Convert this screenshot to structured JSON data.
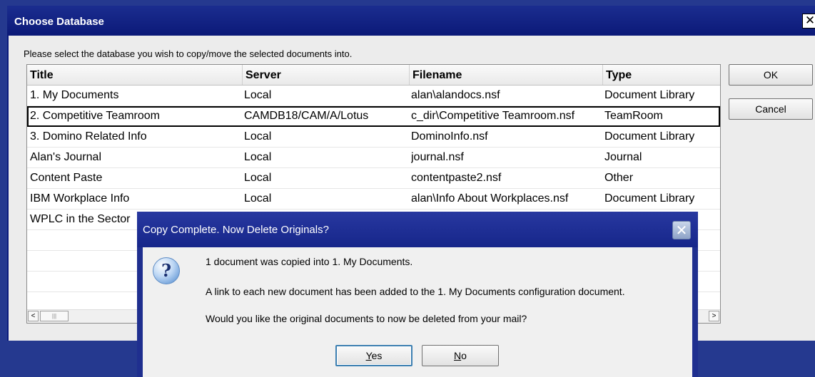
{
  "window": {
    "title": "Choose Database",
    "close_glyph": "✕",
    "instruction": "Please select the database you wish to copy/move the selected documents into."
  },
  "table": {
    "columns": [
      "Title",
      "Server",
      "Filename",
      "Type"
    ],
    "rows": [
      {
        "title": "1. My Documents",
        "server": "Local",
        "filename": "alan\\alandocs.nsf",
        "type": "Document Library"
      },
      {
        "title": "2. Competitive Teamroom",
        "server": "CAMDB18/CAM/A/Lotus",
        "filename": "c_dir\\Competitive Teamroom.nsf",
        "type": "TeamRoom"
      },
      {
        "title": "3. Domino Related Info",
        "server": "Local",
        "filename": "DominoInfo.nsf",
        "type": "Document Library"
      },
      {
        "title": "Alan's Journal",
        "server": "Local",
        "filename": "journal.nsf",
        "type": "Journal"
      },
      {
        "title": "Content Paste",
        "server": "Local",
        "filename": "contentpaste2.nsf",
        "type": "Other"
      },
      {
        "title": "IBM Workplace Info",
        "server": "Local",
        "filename": "alan\\Info About Workplaces.nsf",
        "type": "Document Library"
      },
      {
        "title": "WPLC in the Sector",
        "server": "",
        "filename": "",
        "type": ""
      }
    ],
    "scroll_left": "<",
    "scroll_thumb": "|||",
    "scroll_right": ">"
  },
  "buttons": {
    "ok": "OK",
    "cancel": "Cancel"
  },
  "dialog": {
    "title": "Copy Complete.  Now Delete Originals?",
    "close_glyph": "✕",
    "icon_glyph": "?",
    "line1": "1 document was copied into 1. My Documents.",
    "line2": "A link to each new document has been added to the 1. My Documents configuration document.",
    "line3": "Would you like the original documents to now be deleted from your mail?",
    "yes_first": "Y",
    "yes_rest": "es",
    "no_first": "N",
    "no_rest": "o"
  }
}
